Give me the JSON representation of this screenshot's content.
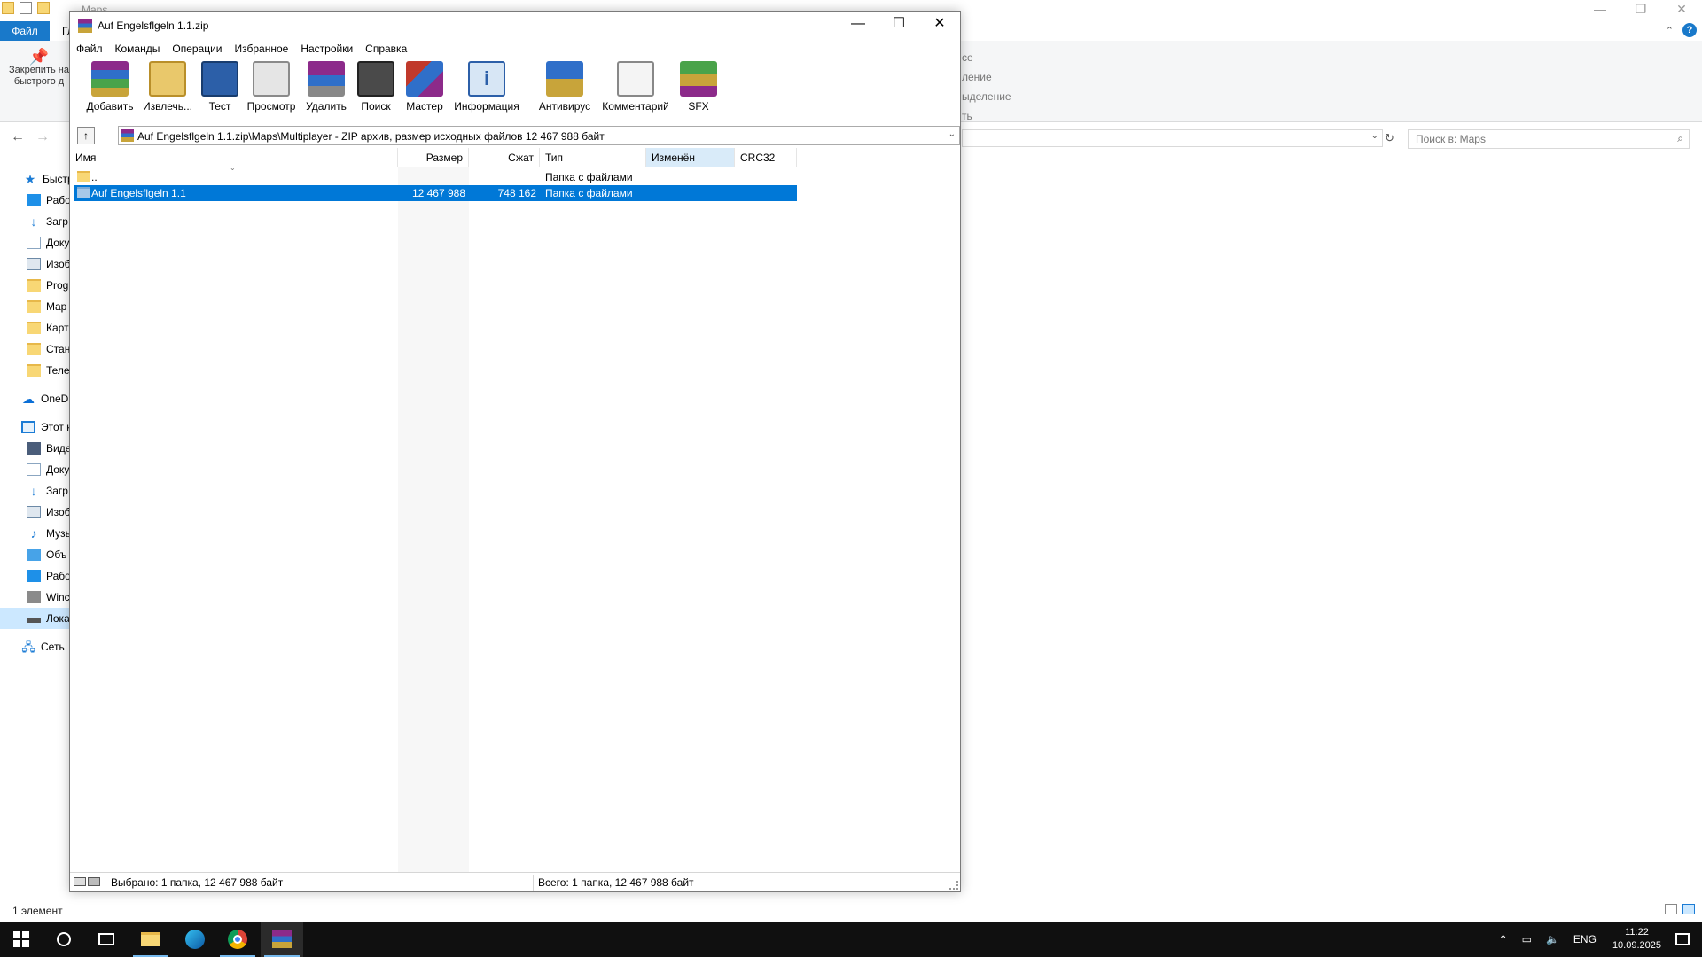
{
  "explorer": {
    "title": "Maps",
    "tab_file": "Файл",
    "tab_home": "Гл",
    "pin_label_1": "Закрепить на",
    "pin_label_2": "быстрого д",
    "ribbon_right_texts": [
      "се",
      "ление",
      "ыделение",
      "ть"
    ],
    "search_placeholder": "Поиск в: Maps",
    "status": "1 элемент",
    "nav_items": [
      {
        "icon": "star-icon",
        "label": "Быстр"
      },
      {
        "icon": "desktop-icon",
        "label": "Рабо"
      },
      {
        "icon": "download-icon",
        "label": "Загр"
      },
      {
        "icon": "document-icon",
        "label": "Доку"
      },
      {
        "icon": "image-icon",
        "label": "Изоб"
      },
      {
        "icon": "folder-icon",
        "label": "Prog"
      },
      {
        "icon": "folder-icon",
        "label": "Map"
      },
      {
        "icon": "folder-icon",
        "label": "Карт"
      },
      {
        "icon": "folder-icon",
        "label": "Стан"
      },
      {
        "icon": "folder-icon",
        "label": "Теле"
      },
      {
        "icon": "cloud-icon",
        "label": "OneDr"
      },
      {
        "icon": "computer-icon",
        "label": "Этот к"
      },
      {
        "icon": "video-icon",
        "label": "Виде"
      },
      {
        "icon": "document-icon",
        "label": "Доку"
      },
      {
        "icon": "download-icon",
        "label": "Загр"
      },
      {
        "icon": "image-icon",
        "label": "Изоб"
      },
      {
        "icon": "music-icon",
        "label": "Музы"
      },
      {
        "icon": "3d-objects-icon",
        "label": "Объ"
      },
      {
        "icon": "desktop-icon",
        "label": "Рабо"
      },
      {
        "icon": "windows-drive-icon",
        "label": "Winc"
      },
      {
        "icon": "local-drive-icon",
        "label": "Лока"
      },
      {
        "icon": "network-icon",
        "label": "Сеть"
      }
    ]
  },
  "winrar": {
    "title": "Auf Engelsflgeln 1.1.zip",
    "menu": [
      "Файл",
      "Команды",
      "Операции",
      "Избранное",
      "Настройки",
      "Справка"
    ],
    "toolbar": [
      {
        "icon": "add-archive-icon",
        "label": "Добавить"
      },
      {
        "icon": "extract-icon",
        "label": "Извлечь..."
      },
      {
        "icon": "test-icon",
        "label": "Тест"
      },
      {
        "icon": "view-icon",
        "label": "Просмотр"
      },
      {
        "icon": "delete-icon",
        "label": "Удалить"
      },
      {
        "icon": "find-icon",
        "label": "Поиск"
      },
      {
        "icon": "wizard-icon",
        "label": "Мастер"
      },
      {
        "icon": "info-icon",
        "label": "Информация"
      },
      {
        "icon": "antivirus-icon",
        "label": "Антивирус"
      },
      {
        "icon": "comment-icon",
        "label": "Комментарий"
      },
      {
        "icon": "sfx-icon",
        "label": "SFX"
      }
    ],
    "path": "Auf Engelsflgeln 1.1.zip\\Maps\\Multiplayer - ZIP архив, размер исходных файлов 12 467 988 байт",
    "columns": [
      "Имя",
      "Размер",
      "Сжат",
      "Тип",
      "Изменён",
      "CRC32"
    ],
    "rows": [
      {
        "name": "..",
        "size": "",
        "packed": "",
        "type": "Папка с файлами",
        "modified": "",
        "crc": ""
      },
      {
        "name": "Auf Engelsflgeln 1.1",
        "size": "12 467 988",
        "packed": "748 162",
        "type": "Папка с файлами",
        "modified": "",
        "crc": ""
      }
    ],
    "status_left": "Выбрано: 1 папка, 12 467 988 байт",
    "status_right": "Всего: 1 папка, 12 467 988 байт"
  },
  "taskbar": {
    "lang": "ENG",
    "time": "11:22",
    "date": "10.09.2025"
  },
  "colors": {
    "selection": "#0078d7",
    "accent": "#1979ca",
    "taskbar": "#101010"
  }
}
